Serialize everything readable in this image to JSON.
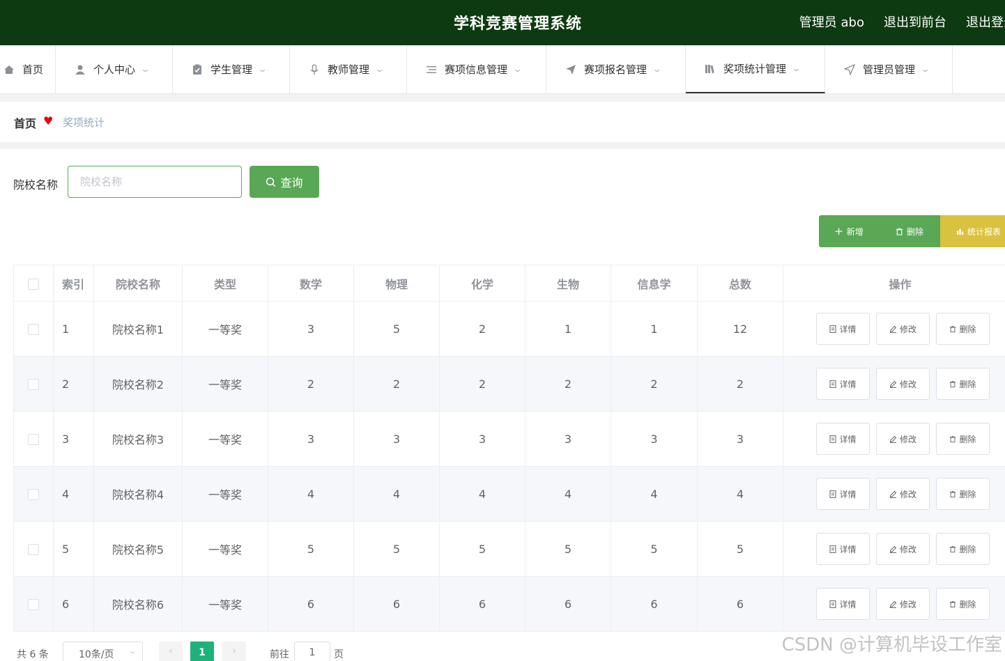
{
  "header": {
    "title": "学科竞赛管理系统",
    "user": "管理员 abo",
    "to_front": "退出到前台",
    "logout": "退出登录"
  },
  "nav": {
    "items": [
      {
        "label": "首页",
        "icon": "home-icon"
      },
      {
        "label": "个人中心",
        "icon": "user-icon"
      },
      {
        "label": "学生管理",
        "icon": "clipboard-icon"
      },
      {
        "label": "教师管理",
        "icon": "microphone-icon"
      },
      {
        "label": "赛项信息管理",
        "icon": "list-icon"
      },
      {
        "label": "赛项报名管理",
        "icon": "send-icon"
      },
      {
        "label": "奖项统计管理",
        "icon": "books-icon"
      },
      {
        "label": "管理员管理",
        "icon": "position-icon"
      }
    ],
    "active": "奖项统计管理"
  },
  "breadcrumb": {
    "home": "首页",
    "current": "奖项统计"
  },
  "search": {
    "label": "院校名称",
    "placeholder": "院校名称",
    "button": "查询"
  },
  "actions": {
    "add": "新增",
    "delete": "删除",
    "report": "统计报表"
  },
  "table": {
    "columns": [
      "索引",
      "院校名称",
      "类型",
      "数学",
      "物理",
      "化学",
      "生物",
      "信息学",
      "总数",
      "操作"
    ],
    "rows": [
      {
        "index": "1",
        "school": "院校名称1",
        "type": "一等奖",
        "math": "3",
        "physics": "5",
        "chemistry": "2",
        "biology": "1",
        "informatics": "1",
        "total": "12"
      },
      {
        "index": "2",
        "school": "院校名称2",
        "type": "一等奖",
        "math": "2",
        "physics": "2",
        "chemistry": "2",
        "biology": "2",
        "informatics": "2",
        "total": "2"
      },
      {
        "index": "3",
        "school": "院校名称3",
        "type": "一等奖",
        "math": "3",
        "physics": "3",
        "chemistry": "3",
        "biology": "3",
        "informatics": "3",
        "total": "3"
      },
      {
        "index": "4",
        "school": "院校名称4",
        "type": "一等奖",
        "math": "4",
        "physics": "4",
        "chemistry": "4",
        "biology": "4",
        "informatics": "4",
        "total": "4"
      },
      {
        "index": "5",
        "school": "院校名称5",
        "type": "一等奖",
        "math": "5",
        "physics": "5",
        "chemistry": "5",
        "biology": "5",
        "informatics": "5",
        "total": "5"
      },
      {
        "index": "6",
        "school": "院校名称6",
        "type": "一等奖",
        "math": "6",
        "physics": "6",
        "chemistry": "6",
        "biology": "6",
        "informatics": "6",
        "total": "6"
      }
    ],
    "row_actions": {
      "detail": "详情",
      "edit": "修改",
      "delete": "删除"
    }
  },
  "pagination": {
    "total": "共 6 条",
    "page_size": "10条/页",
    "current": "1",
    "goto_prefix": "前往",
    "goto_value": "1",
    "goto_suffix": "页"
  },
  "watermark": "CSDN @计算机毕设工作室",
  "colors": {
    "header_bg": "#0e3a11",
    "primary": "#5aa855",
    "report": "#d9c23e",
    "page_active": "#1db27c",
    "heart": "#e60012"
  }
}
